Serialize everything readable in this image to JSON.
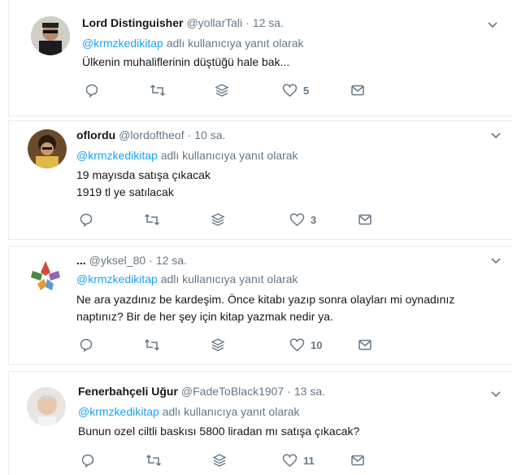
{
  "colors": {
    "accent": "#1da1f2",
    "muted": "#657786",
    "border": "#e6ecf0"
  },
  "tweets": [
    {
      "name": "Lord Distinguisher",
      "handle": "@yollarTali",
      "sep": "·",
      "time": "12 sa.",
      "reply_mention": "@krmzkedikitap",
      "reply_suffix": "adlı kullanıcıya yanıt olarak",
      "lines": [
        "Ülkenin muhaliflerinin düştüğü hale bak..."
      ],
      "likes": "5",
      "icons": [
        "reply-icon",
        "retweet-icon",
        "stack-icon",
        "heart-icon",
        "mail-icon",
        "chevron-down-icon"
      ]
    },
    {
      "name": "oflordu",
      "handle": "@lordoftheof",
      "sep": "·",
      "time": "10 sa.",
      "reply_mention": "@krmzkedikitap",
      "reply_suffix": "adlı kullanıcıya yanıt olarak",
      "lines": [
        "19 mayısda satışa çıkacak",
        "1919 tl ye satılacak"
      ],
      "likes": "3",
      "icons": [
        "reply-icon",
        "retweet-icon",
        "stack-icon",
        "heart-icon",
        "mail-icon",
        "chevron-down-icon"
      ]
    },
    {
      "name": "...",
      "handle": "@yksel_80",
      "sep": "·",
      "time": "12 sa.",
      "reply_mention": "@krmzkedikitap",
      "reply_suffix": "adlı kullanıcıya yanıt olarak",
      "lines": [
        "Ne ara yazdınız be kardeşim.  Önce kitabı yazıp sonra olayları mi oynadınız",
        "naptınız? Bir de her şey için kitap yazmak nedir ya."
      ],
      "likes": "10",
      "icons": [
        "reply-icon",
        "retweet-icon",
        "stack-icon",
        "heart-icon",
        "mail-icon",
        "chevron-down-icon"
      ]
    },
    {
      "name": "Fenerbahçeli Uğur",
      "handle": "@FadeToBlack1907",
      "sep": "·",
      "time": "13 sa.",
      "reply_mention": "@krmzkedikitap",
      "reply_suffix": "adlı kullanıcıya yanıt olarak",
      "lines": [
        "Bunun ozel ciltli baskısı 5800 liradan mı satışa çıkacak?"
      ],
      "likes": "11",
      "icons": [
        "reply-icon",
        "retweet-icon",
        "stack-icon",
        "heart-icon",
        "mail-icon",
        "chevron-down-icon"
      ]
    }
  ]
}
